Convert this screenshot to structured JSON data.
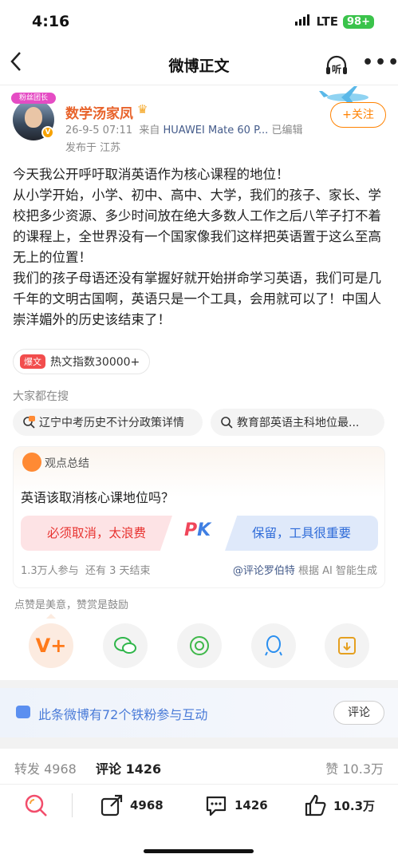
{
  "status": {
    "time": "4:16",
    "network": "LTE",
    "battery": "98+"
  },
  "nav": {
    "title": "微博正文",
    "listen_label": "听"
  },
  "author": {
    "name": "数学汤家凤",
    "badge_text": "粉丝团长",
    "timestamp": "26-9-5 07:11",
    "source_prefix": "来自",
    "device": "HUAWEI Mate 60 P...",
    "edited": "已编辑",
    "location": "发布于 江苏",
    "follow_label": "+关注"
  },
  "post": {
    "lines": [
      "今天我公开呼吁取消英语作为核心课程的地位！",
      "从小学开始，小学、初中、高中、大学，我们的孩子、家长、学校把多少资源、多少时间放在绝大多数人工作之后八竿子打不着的课程上，全世界没有一个国家像我们这样把英语置于这么至高无上的位置！",
      "我们的孩子母语还没有掌握好就开始拼命学习英语，我们可是几千年的文明古国啊，英语只是一个工具，会用就可以了！中国人崇洋媚外的历史该结束了！"
    ]
  },
  "hot": {
    "badge": "爆文",
    "label": "热文指数30000+"
  },
  "searching": {
    "title": "大家都在搜",
    "chips": [
      "辽宁中考历史不计分政策详情",
      "教育部英语主科地位最..."
    ]
  },
  "opinion": {
    "title": "观点总结",
    "question": "英语该取消核心课地位吗？",
    "option_left": "必须取消，太浪费",
    "option_right": "保留，工具很重要",
    "pk_p": "P",
    "pk_k": "K",
    "participants": "1.3万人参与",
    "ends": "还有 3 天结束",
    "credit_at": "@评论罗伯特",
    "credit_rest": "根据 AI 智能生成"
  },
  "appreciation": {
    "note": "点赞是美意，赞赏是鼓励"
  },
  "fans": {
    "text": "此条微博有72个铁粉参与互动",
    "button": "评论"
  },
  "tabs": {
    "repost": "转发 4968",
    "comment": "评论 1426",
    "like": "赞 10.3万"
  },
  "bottom": {
    "repost": "4968",
    "comment": "1426",
    "like": "10.3万"
  }
}
